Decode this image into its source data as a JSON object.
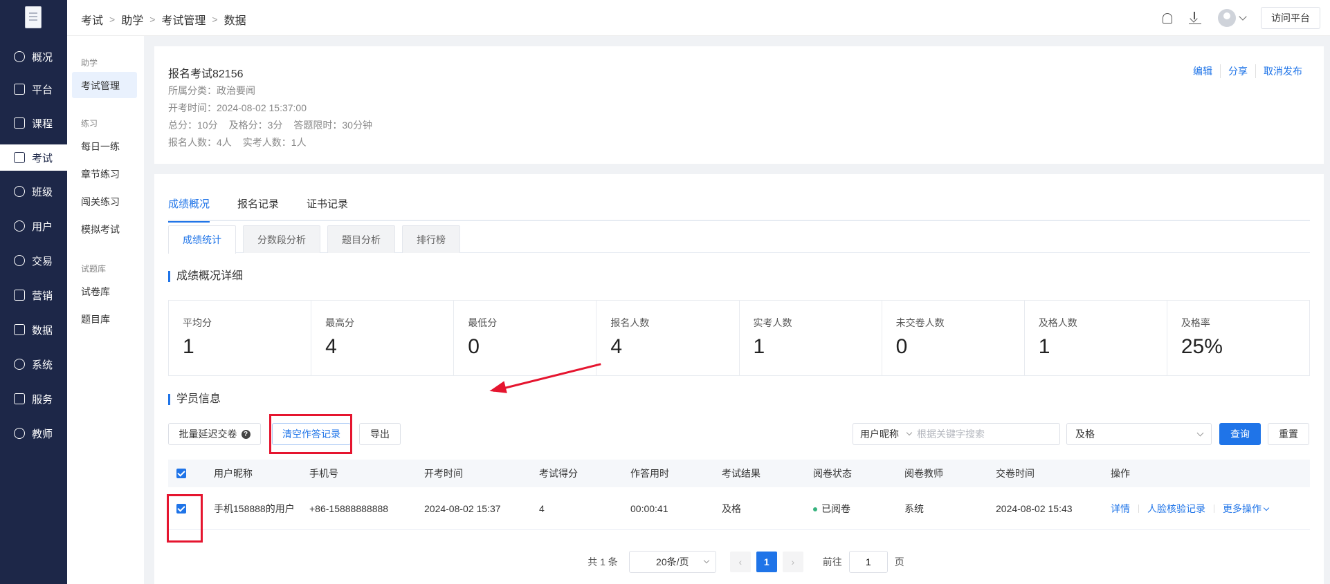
{
  "nav": {
    "items": [
      {
        "label": "概况",
        "icon": "pie-chart-icon"
      },
      {
        "label": "平台",
        "icon": "store-icon"
      },
      {
        "label": "课程",
        "icon": "book-icon"
      },
      {
        "label": "考试",
        "icon": "exam-icon",
        "active": true
      },
      {
        "label": "班级",
        "icon": "group-icon"
      },
      {
        "label": "用户",
        "icon": "user-icon"
      },
      {
        "label": "交易",
        "icon": "yen-icon"
      },
      {
        "label": "营销",
        "icon": "megaphone-icon"
      },
      {
        "label": "数据",
        "icon": "bar-chart-icon"
      },
      {
        "label": "系统",
        "icon": "settings-icon"
      },
      {
        "label": "服务",
        "icon": "hand-service-icon"
      },
      {
        "label": "教师",
        "icon": "teacher-icon"
      }
    ]
  },
  "submenu": {
    "group1": "助学",
    "item_exam_mgmt": "考试管理",
    "group2": "练习",
    "daily": "每日一练",
    "chapter": "章节练习",
    "level": "闯关练习",
    "mock": "模拟考试",
    "group3": "试题库",
    "paper_lib": "试卷库",
    "question_lib": "题目库"
  },
  "breadcrumb": [
    "考试",
    "助学",
    "考试管理",
    "数据"
  ],
  "topbar": {
    "visit_label": "访问平台"
  },
  "exam": {
    "title": "报名考试82156",
    "category": "所属分类：政治要闻",
    "start_time": "开考时间：2024-08-02 15:37:00",
    "total": "总分：10分",
    "pass": "及格分：3分",
    "limit": "答题限时：30分钟",
    "enrolled": "报名人数：4人",
    "actual": "实考人数：1人",
    "actions": [
      "编辑",
      "分享",
      "取消发布"
    ]
  },
  "tabs_main": [
    "成绩概况",
    "报名记录",
    "证书记录"
  ],
  "tabs_sub": [
    "成绩统计",
    "分数段分析",
    "题目分析",
    "排行榜"
  ],
  "section_overview": "成绩概况详细",
  "stats": [
    {
      "label": "平均分",
      "value": "1"
    },
    {
      "label": "最高分",
      "value": "4"
    },
    {
      "label": "最低分",
      "value": "0"
    },
    {
      "label": "报名人数",
      "value": "4"
    },
    {
      "label": "实考人数",
      "value": "1"
    },
    {
      "label": "未交卷人数",
      "value": "0"
    },
    {
      "label": "及格人数",
      "value": "1"
    },
    {
      "label": "及格率",
      "value": "25%"
    }
  ],
  "section_students": "学员信息",
  "toolbar": {
    "batch_delay": "批量延迟交卷",
    "clear_records": "清空作答记录",
    "export": "导出",
    "search_field": "用户昵称",
    "search_placeholder": "根据关键字搜索",
    "status_value": "及格",
    "query": "查询",
    "reset": "重置"
  },
  "table": {
    "headers": [
      "用户昵称",
      "手机号",
      "开考时间",
      "考试得分",
      "作答用时",
      "考试结果",
      "阅卷状态",
      "阅卷教师",
      "交卷时间",
      "操作"
    ],
    "rows": [
      {
        "nickname": "手机158888的用户",
        "phone": "+86-15888888888",
        "start": "2024-08-02 15:37",
        "score": "4",
        "duration": "00:00:41",
        "result": "及格",
        "review_status": "已阅卷",
        "teacher": "系统",
        "submit": "2024-08-02 15:43",
        "ops": [
          "详情",
          "人脸核验记录",
          "更多操作"
        ]
      }
    ]
  },
  "pager": {
    "total": "共 1 条",
    "page_size": "20条/页",
    "prev": "‹",
    "current": "1",
    "next": "›",
    "goto_label": "前往",
    "goto_value": "1",
    "page_suffix": "页"
  },
  "colors": {
    "accent": "#1f74e8",
    "nav_bg": "#1d2748",
    "highlight": "#e5152f"
  }
}
